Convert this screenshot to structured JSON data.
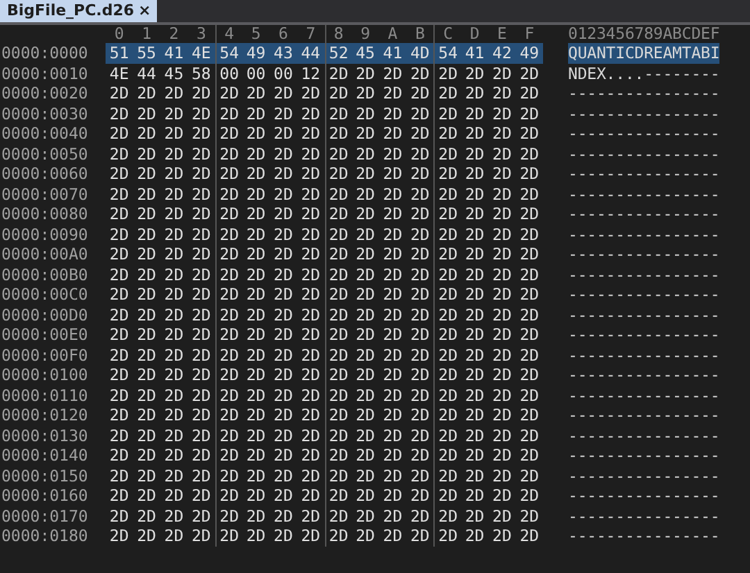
{
  "tab": {
    "title": "BigFile_PC.d26",
    "close": "×",
    "selected": true
  },
  "columns": [
    "0",
    "1",
    "2",
    "3",
    "4",
    "5",
    "6",
    "7",
    "8",
    "9",
    "A",
    "B",
    "C",
    "D",
    "E",
    "F"
  ],
  "ascii_header": "0123456789ABCDEF",
  "rows": [
    {
      "offset": "0000:0000",
      "bytes": [
        "51",
        "55",
        "41",
        "4E",
        "54",
        "49",
        "43",
        "44",
        "52",
        "45",
        "41",
        "4D",
        "54",
        "41",
        "42",
        "49"
      ],
      "ascii": "QUANTICDREAMTABI",
      "selected": true
    },
    {
      "offset": "0000:0010",
      "bytes": [
        "4E",
        "44",
        "45",
        "58",
        "00",
        "00",
        "00",
        "12",
        "2D",
        "2D",
        "2D",
        "2D",
        "2D",
        "2D",
        "2D",
        "2D"
      ],
      "ascii": "NDEX....--------",
      "selected": false
    },
    {
      "offset": "0000:0020",
      "bytes": [
        "2D",
        "2D",
        "2D",
        "2D",
        "2D",
        "2D",
        "2D",
        "2D",
        "2D",
        "2D",
        "2D",
        "2D",
        "2D",
        "2D",
        "2D",
        "2D"
      ],
      "ascii": "----------------",
      "selected": false
    },
    {
      "offset": "0000:0030",
      "bytes": [
        "2D",
        "2D",
        "2D",
        "2D",
        "2D",
        "2D",
        "2D",
        "2D",
        "2D",
        "2D",
        "2D",
        "2D",
        "2D",
        "2D",
        "2D",
        "2D"
      ],
      "ascii": "----------------",
      "selected": false
    },
    {
      "offset": "0000:0040",
      "bytes": [
        "2D",
        "2D",
        "2D",
        "2D",
        "2D",
        "2D",
        "2D",
        "2D",
        "2D",
        "2D",
        "2D",
        "2D",
        "2D",
        "2D",
        "2D",
        "2D"
      ],
      "ascii": "----------------",
      "selected": false
    },
    {
      "offset": "0000:0050",
      "bytes": [
        "2D",
        "2D",
        "2D",
        "2D",
        "2D",
        "2D",
        "2D",
        "2D",
        "2D",
        "2D",
        "2D",
        "2D",
        "2D",
        "2D",
        "2D",
        "2D"
      ],
      "ascii": "----------------",
      "selected": false
    },
    {
      "offset": "0000:0060",
      "bytes": [
        "2D",
        "2D",
        "2D",
        "2D",
        "2D",
        "2D",
        "2D",
        "2D",
        "2D",
        "2D",
        "2D",
        "2D",
        "2D",
        "2D",
        "2D",
        "2D"
      ],
      "ascii": "----------------",
      "selected": false
    },
    {
      "offset": "0000:0070",
      "bytes": [
        "2D",
        "2D",
        "2D",
        "2D",
        "2D",
        "2D",
        "2D",
        "2D",
        "2D",
        "2D",
        "2D",
        "2D",
        "2D",
        "2D",
        "2D",
        "2D"
      ],
      "ascii": "----------------",
      "selected": false
    },
    {
      "offset": "0000:0080",
      "bytes": [
        "2D",
        "2D",
        "2D",
        "2D",
        "2D",
        "2D",
        "2D",
        "2D",
        "2D",
        "2D",
        "2D",
        "2D",
        "2D",
        "2D",
        "2D",
        "2D"
      ],
      "ascii": "----------------",
      "selected": false
    },
    {
      "offset": "0000:0090",
      "bytes": [
        "2D",
        "2D",
        "2D",
        "2D",
        "2D",
        "2D",
        "2D",
        "2D",
        "2D",
        "2D",
        "2D",
        "2D",
        "2D",
        "2D",
        "2D",
        "2D"
      ],
      "ascii": "----------------",
      "selected": false
    },
    {
      "offset": "0000:00A0",
      "bytes": [
        "2D",
        "2D",
        "2D",
        "2D",
        "2D",
        "2D",
        "2D",
        "2D",
        "2D",
        "2D",
        "2D",
        "2D",
        "2D",
        "2D",
        "2D",
        "2D"
      ],
      "ascii": "----------------",
      "selected": false
    },
    {
      "offset": "0000:00B0",
      "bytes": [
        "2D",
        "2D",
        "2D",
        "2D",
        "2D",
        "2D",
        "2D",
        "2D",
        "2D",
        "2D",
        "2D",
        "2D",
        "2D",
        "2D",
        "2D",
        "2D"
      ],
      "ascii": "----------------",
      "selected": false
    },
    {
      "offset": "0000:00C0",
      "bytes": [
        "2D",
        "2D",
        "2D",
        "2D",
        "2D",
        "2D",
        "2D",
        "2D",
        "2D",
        "2D",
        "2D",
        "2D",
        "2D",
        "2D",
        "2D",
        "2D"
      ],
      "ascii": "----------------",
      "selected": false
    },
    {
      "offset": "0000:00D0",
      "bytes": [
        "2D",
        "2D",
        "2D",
        "2D",
        "2D",
        "2D",
        "2D",
        "2D",
        "2D",
        "2D",
        "2D",
        "2D",
        "2D",
        "2D",
        "2D",
        "2D"
      ],
      "ascii": "----------------",
      "selected": false
    },
    {
      "offset": "0000:00E0",
      "bytes": [
        "2D",
        "2D",
        "2D",
        "2D",
        "2D",
        "2D",
        "2D",
        "2D",
        "2D",
        "2D",
        "2D",
        "2D",
        "2D",
        "2D",
        "2D",
        "2D"
      ],
      "ascii": "----------------",
      "selected": false
    },
    {
      "offset": "0000:00F0",
      "bytes": [
        "2D",
        "2D",
        "2D",
        "2D",
        "2D",
        "2D",
        "2D",
        "2D",
        "2D",
        "2D",
        "2D",
        "2D",
        "2D",
        "2D",
        "2D",
        "2D"
      ],
      "ascii": "----------------",
      "selected": false
    },
    {
      "offset": "0000:0100",
      "bytes": [
        "2D",
        "2D",
        "2D",
        "2D",
        "2D",
        "2D",
        "2D",
        "2D",
        "2D",
        "2D",
        "2D",
        "2D",
        "2D",
        "2D",
        "2D",
        "2D"
      ],
      "ascii": "----------------",
      "selected": false
    },
    {
      "offset": "0000:0110",
      "bytes": [
        "2D",
        "2D",
        "2D",
        "2D",
        "2D",
        "2D",
        "2D",
        "2D",
        "2D",
        "2D",
        "2D",
        "2D",
        "2D",
        "2D",
        "2D",
        "2D"
      ],
      "ascii": "----------------",
      "selected": false
    },
    {
      "offset": "0000:0120",
      "bytes": [
        "2D",
        "2D",
        "2D",
        "2D",
        "2D",
        "2D",
        "2D",
        "2D",
        "2D",
        "2D",
        "2D",
        "2D",
        "2D",
        "2D",
        "2D",
        "2D"
      ],
      "ascii": "----------------",
      "selected": false
    },
    {
      "offset": "0000:0130",
      "bytes": [
        "2D",
        "2D",
        "2D",
        "2D",
        "2D",
        "2D",
        "2D",
        "2D",
        "2D",
        "2D",
        "2D",
        "2D",
        "2D",
        "2D",
        "2D",
        "2D"
      ],
      "ascii": "----------------",
      "selected": false
    },
    {
      "offset": "0000:0140",
      "bytes": [
        "2D",
        "2D",
        "2D",
        "2D",
        "2D",
        "2D",
        "2D",
        "2D",
        "2D",
        "2D",
        "2D",
        "2D",
        "2D",
        "2D",
        "2D",
        "2D"
      ],
      "ascii": "----------------",
      "selected": false
    },
    {
      "offset": "0000:0150",
      "bytes": [
        "2D",
        "2D",
        "2D",
        "2D",
        "2D",
        "2D",
        "2D",
        "2D",
        "2D",
        "2D",
        "2D",
        "2D",
        "2D",
        "2D",
        "2D",
        "2D"
      ],
      "ascii": "----------------",
      "selected": false
    },
    {
      "offset": "0000:0160",
      "bytes": [
        "2D",
        "2D",
        "2D",
        "2D",
        "2D",
        "2D",
        "2D",
        "2D",
        "2D",
        "2D",
        "2D",
        "2D",
        "2D",
        "2D",
        "2D",
        "2D"
      ],
      "ascii": "----------------",
      "selected": false
    },
    {
      "offset": "0000:0170",
      "bytes": [
        "2D",
        "2D",
        "2D",
        "2D",
        "2D",
        "2D",
        "2D",
        "2D",
        "2D",
        "2D",
        "2D",
        "2D",
        "2D",
        "2D",
        "2D",
        "2D"
      ],
      "ascii": "----------------",
      "selected": false
    },
    {
      "offset": "0000:0180",
      "bytes": [
        "2D",
        "2D",
        "2D",
        "2D",
        "2D",
        "2D",
        "2D",
        "2D",
        "2D",
        "2D",
        "2D",
        "2D",
        "2D",
        "2D",
        "2D",
        "2D"
      ],
      "ascii": "----------------",
      "selected": false
    }
  ]
}
